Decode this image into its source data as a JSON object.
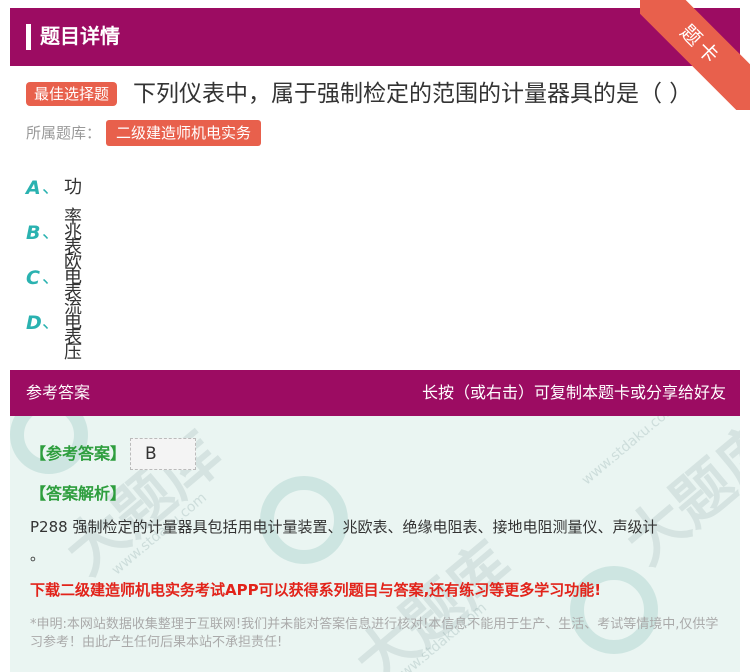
{
  "header": {
    "title": "题目详情",
    "corner": "题卡"
  },
  "question": {
    "type_tag": "最佳选择题",
    "text": "下列仪表中，属于强制检定的范围的计量器具的是（   ）",
    "bank_label": "所属题库：",
    "bank_name": "二级建造师机电实务"
  },
  "options": [
    {
      "letter": "A",
      "sep": "、",
      "text": "功率表"
    },
    {
      "letter": "B",
      "sep": "、",
      "text": "兆欧表"
    },
    {
      "letter": "C",
      "sep": "、",
      "text": "电流表"
    },
    {
      "letter": "D",
      "sep": "、",
      "text": "电压表"
    }
  ],
  "answer": {
    "section_title": "参考答案",
    "share_hint": "长按（或右击）可复制本题卡或分享给好友",
    "ref_label": "【参考答案】",
    "ref_value": "B",
    "explain_label": "【答案解析】",
    "explain_text": "P288 强制检定的计量器具包括用电计量装置、兆欧表、绝缘电阻表、接地电阻测量仪、声级计",
    "explain_tail": "。",
    "promo": "下载二级建造师机电实务考试APP可以获得系列题目与答案,还有练习等更多学习功能!",
    "disclaimer": "*申明:本网站数据收集整理于互联网!我们并未能对答案信息进行核对!本信息不能用于生产、生活、考试等情境中,仅供学习参考！由此产生任何后果本站不承担责任!"
  },
  "watermark": {
    "text": "大题库",
    "site": "www.stdaku.com"
  },
  "colors": {
    "brand": "#9c0c62",
    "accent": "#e8604c",
    "option": "#2ab2b0",
    "answer_label": "#2e9e3e",
    "promo": "#e2231a"
  }
}
